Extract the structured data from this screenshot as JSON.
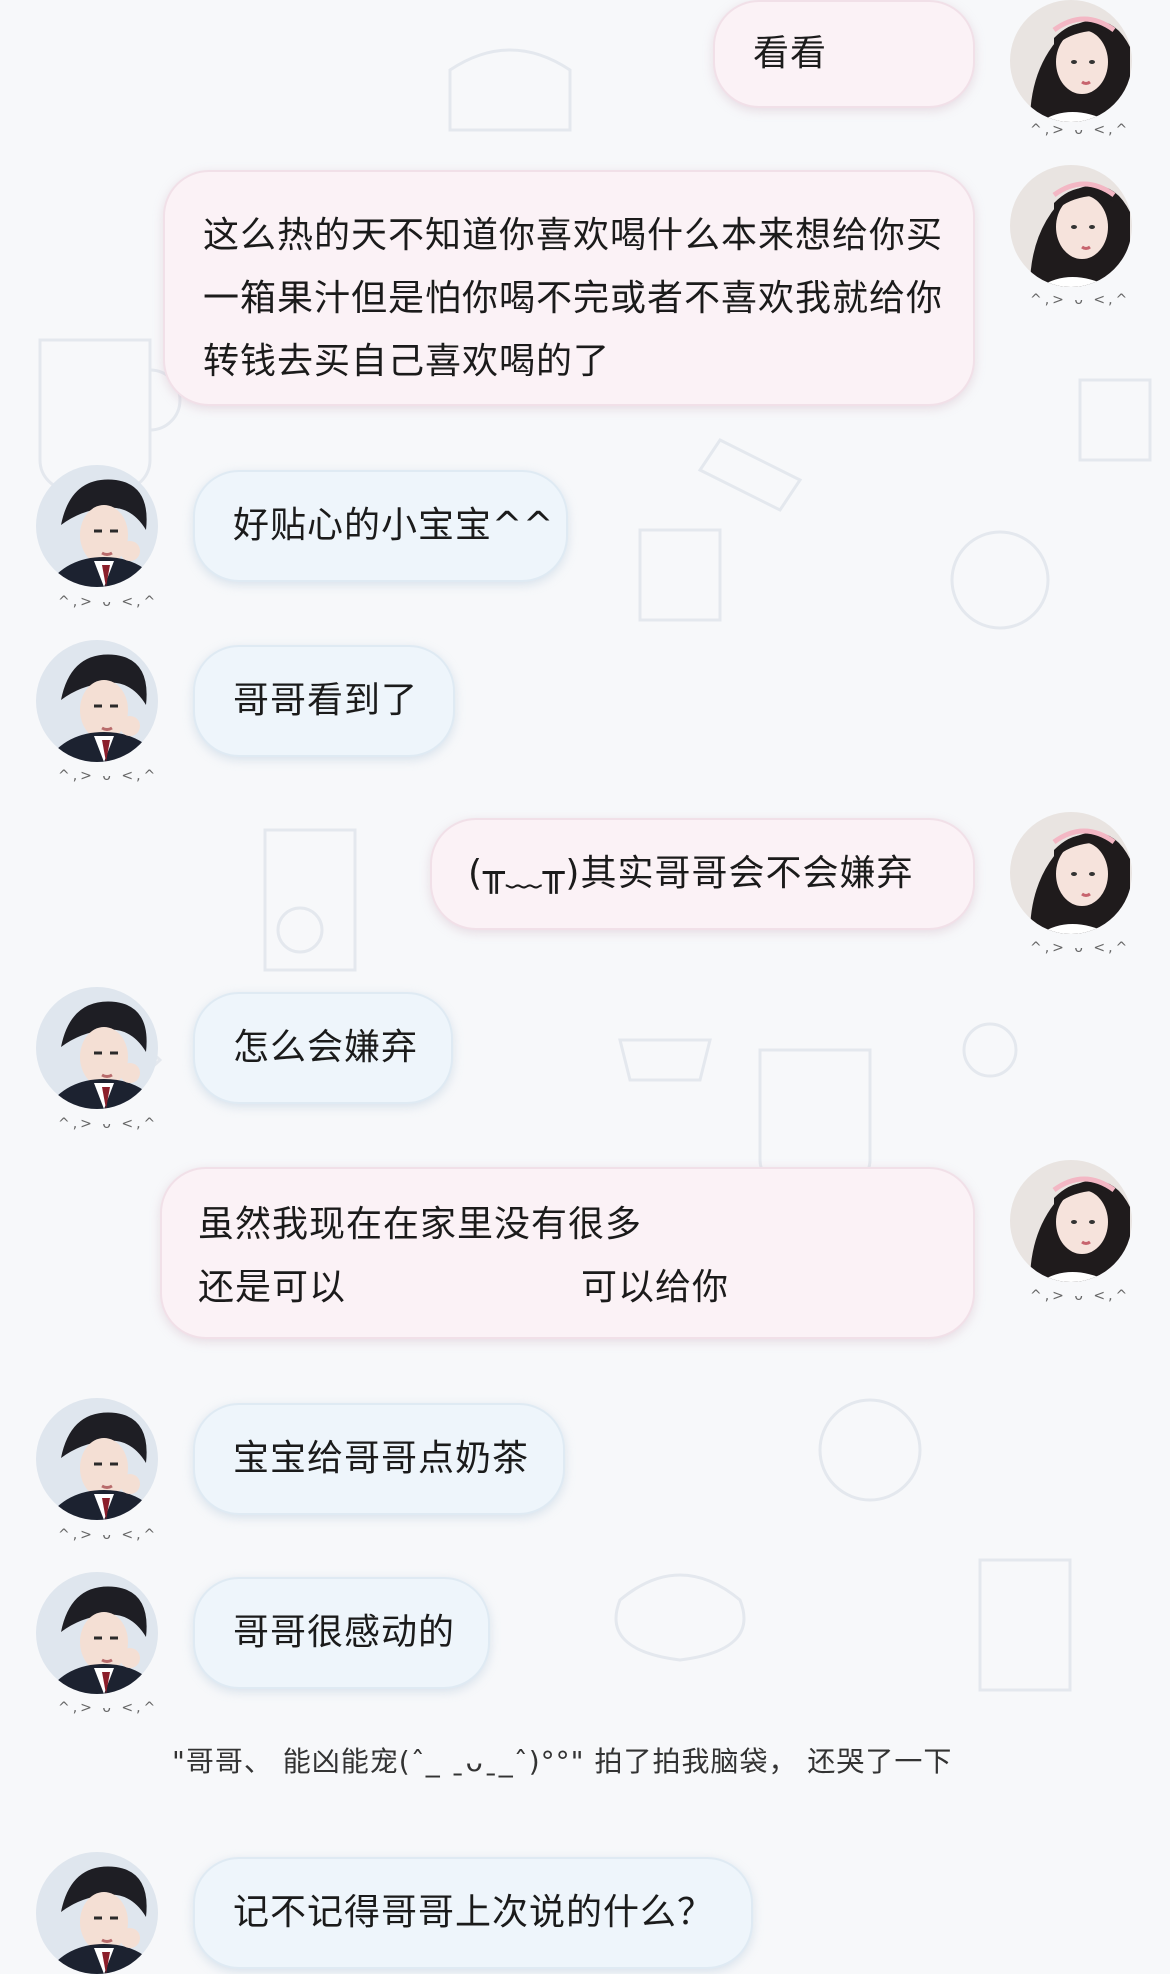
{
  "colors": {
    "me_bubble": "#fbf2f6",
    "them_bubble": "#eef5fb",
    "background": "#f7f8fa"
  },
  "avatars": {
    "me": "girl-avatar",
    "them": "boy-avatar",
    "emote": "^,> ᴗ <,^"
  },
  "messages": [
    {
      "sender": "me",
      "text": "看看"
    },
    {
      "sender": "me",
      "lines": [
        "这么热的天不知道你喜欢喝什么本来想给你买",
        "一箱果汁但是怕你喝不完或者不喜欢我就给你",
        "转钱去买自己喜欢喝的了"
      ]
    },
    {
      "sender": "them",
      "text": "好贴心的小宝宝^^"
    },
    {
      "sender": "them",
      "text": "哥哥看到了"
    },
    {
      "sender": "me",
      "text": "(╥﹏╥)其实哥哥会不会嫌弃"
    },
    {
      "sender": "them",
      "text": "怎么会嫌弃"
    },
    {
      "sender": "me",
      "line1": "虽然我现在在家里没有很多",
      "line2a": "还是可以",
      "line2b": "可以给你"
    },
    {
      "sender": "them",
      "text": "宝宝给哥哥点奶茶"
    },
    {
      "sender": "them",
      "text": "哥哥很感动的"
    },
    {
      "sender": "them",
      "text": "记不记得哥哥上次说的什么？"
    }
  ],
  "system_message": "\"哥哥、 能凶能宠(ˆ_ ˍᴗˍ_ˆ)°°\" 拍了拍我脑袋， 还哭了一下"
}
